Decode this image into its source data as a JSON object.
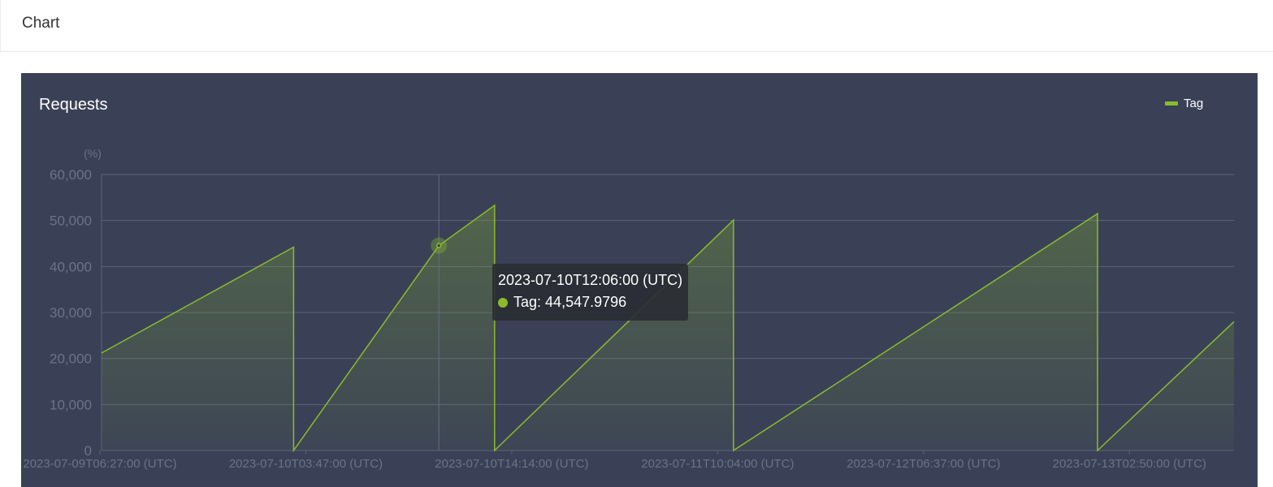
{
  "page": {
    "title": "Chart"
  },
  "chart_data": {
    "type": "area",
    "title": "Requests",
    "ylabel": "(%)",
    "xlabel": "",
    "ylim": [
      0,
      60000
    ],
    "y_ticks": [
      0,
      10000,
      20000,
      30000,
      40000,
      50000,
      60000
    ],
    "y_tick_labels": [
      "0",
      "10,000",
      "20,000",
      "30,000",
      "40,000",
      "50,000",
      "60,000"
    ],
    "x_ticks": [
      "2023-07-09T06:27:00 (UTC)",
      "2023-07-10T03:47:00 (UTC)",
      "2023-07-10T14:14:00 (UTC)",
      "2023-07-11T10:04:00 (UTC)",
      "2023-07-12T06:37:00 (UTC)",
      "2023-07-13T02:50:00 (UTC)"
    ],
    "grid": true,
    "legend_position": "top-right",
    "colors": {
      "series": "#8bbb2b",
      "background": "#3a4157"
    },
    "series": [
      {
        "name": "Tag",
        "points": [
          {
            "x": "2023-07-09T06:27:00",
            "y": 21200
          },
          {
            "x": "2023-07-09T23:20:00",
            "y": 44200
          },
          {
            "x": "2023-07-09T23:20:00",
            "y": 0
          },
          {
            "x": "2023-07-10T12:06:00",
            "y": 44547.9796
          },
          {
            "x": "2023-07-10T17:00:00",
            "y": 53300
          },
          {
            "x": "2023-07-10T17:00:00",
            "y": 0
          },
          {
            "x": "2023-07-11T14:00:00",
            "y": 50100
          },
          {
            "x": "2023-07-11T14:00:00",
            "y": 0
          },
          {
            "x": "2023-07-12T22:00:00",
            "y": 51500
          },
          {
            "x": "2023-07-12T22:00:00",
            "y": 0
          },
          {
            "x": "2023-07-13T10:00:00",
            "y": 28000
          }
        ]
      }
    ],
    "tooltip": {
      "x": "2023-07-10T12:06:00",
      "title": "2023-07-10T12:06:00 (UTC)",
      "series_name": "Tag",
      "value": 44547.9796,
      "value_text": "44,547.9796"
    }
  }
}
